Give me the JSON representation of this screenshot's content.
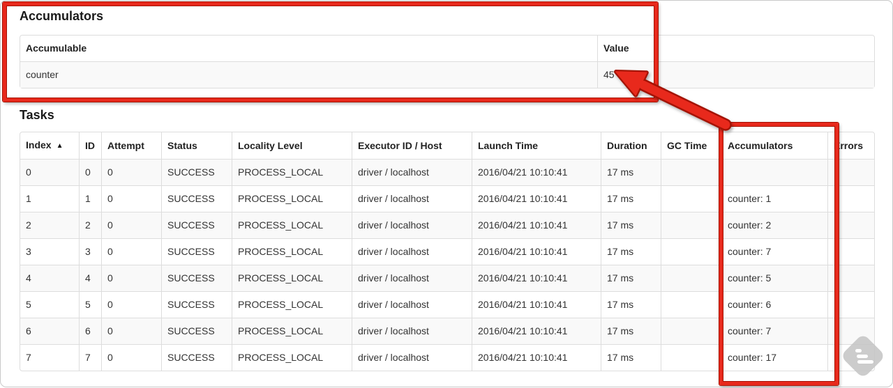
{
  "annotation_color": "#e8291c",
  "annotation_outline_color": "#a41304",
  "watermark_color": "#c6c6c6",
  "accumulators_section": {
    "title": "Accumulators",
    "table": {
      "headers": [
        "Accumulable",
        "Value"
      ],
      "rows": [
        {
          "accumulable": "counter",
          "value": "45"
        }
      ]
    }
  },
  "tasks_section": {
    "title": "Tasks",
    "table": {
      "headers": [
        "Index",
        "ID",
        "Attempt",
        "Status",
        "Locality Level",
        "Executor ID / Host",
        "Launch Time",
        "Duration",
        "GC Time",
        "Accumulators",
        "Errors"
      ],
      "sort": {
        "column": "Index",
        "indicator": "▲"
      },
      "rows": [
        {
          "index": "0",
          "id": "0",
          "attempt": "0",
          "status": "SUCCESS",
          "locality_level": "PROCESS_LOCAL",
          "executor_id_host": "driver / localhost",
          "launch_time": "2016/04/21 10:10:41",
          "duration": "17 ms",
          "gc_time": "",
          "accumulators": "",
          "errors": ""
        },
        {
          "index": "1",
          "id": "1",
          "attempt": "0",
          "status": "SUCCESS",
          "locality_level": "PROCESS_LOCAL",
          "executor_id_host": "driver / localhost",
          "launch_time": "2016/04/21 10:10:41",
          "duration": "17 ms",
          "gc_time": "",
          "accumulators": "counter: 1",
          "errors": ""
        },
        {
          "index": "2",
          "id": "2",
          "attempt": "0",
          "status": "SUCCESS",
          "locality_level": "PROCESS_LOCAL",
          "executor_id_host": "driver / localhost",
          "launch_time": "2016/04/21 10:10:41",
          "duration": "17 ms",
          "gc_time": "",
          "accumulators": "counter: 2",
          "errors": ""
        },
        {
          "index": "3",
          "id": "3",
          "attempt": "0",
          "status": "SUCCESS",
          "locality_level": "PROCESS_LOCAL",
          "executor_id_host": "driver / localhost",
          "launch_time": "2016/04/21 10:10:41",
          "duration": "17 ms",
          "gc_time": "",
          "accumulators": "counter: 7",
          "errors": ""
        },
        {
          "index": "4",
          "id": "4",
          "attempt": "0",
          "status": "SUCCESS",
          "locality_level": "PROCESS_LOCAL",
          "executor_id_host": "driver / localhost",
          "launch_time": "2016/04/21 10:10:41",
          "duration": "17 ms",
          "gc_time": "",
          "accumulators": "counter: 5",
          "errors": ""
        },
        {
          "index": "5",
          "id": "5",
          "attempt": "0",
          "status": "SUCCESS",
          "locality_level": "PROCESS_LOCAL",
          "executor_id_host": "driver / localhost",
          "launch_time": "2016/04/21 10:10:41",
          "duration": "17 ms",
          "gc_time": "",
          "accumulators": "counter: 6",
          "errors": ""
        },
        {
          "index": "6",
          "id": "6",
          "attempt": "0",
          "status": "SUCCESS",
          "locality_level": "PROCESS_LOCAL",
          "executor_id_host": "driver / localhost",
          "launch_time": "2016/04/21 10:10:41",
          "duration": "17 ms",
          "gc_time": "",
          "accumulators": "counter: 7",
          "errors": ""
        },
        {
          "index": "7",
          "id": "7",
          "attempt": "0",
          "status": "SUCCESS",
          "locality_level": "PROCESS_LOCAL",
          "executor_id_host": "driver / localhost",
          "launch_time": "2016/04/21 10:10:41",
          "duration": "17 ms",
          "gc_time": "",
          "accumulators": "counter: 17",
          "errors": ""
        }
      ]
    }
  }
}
